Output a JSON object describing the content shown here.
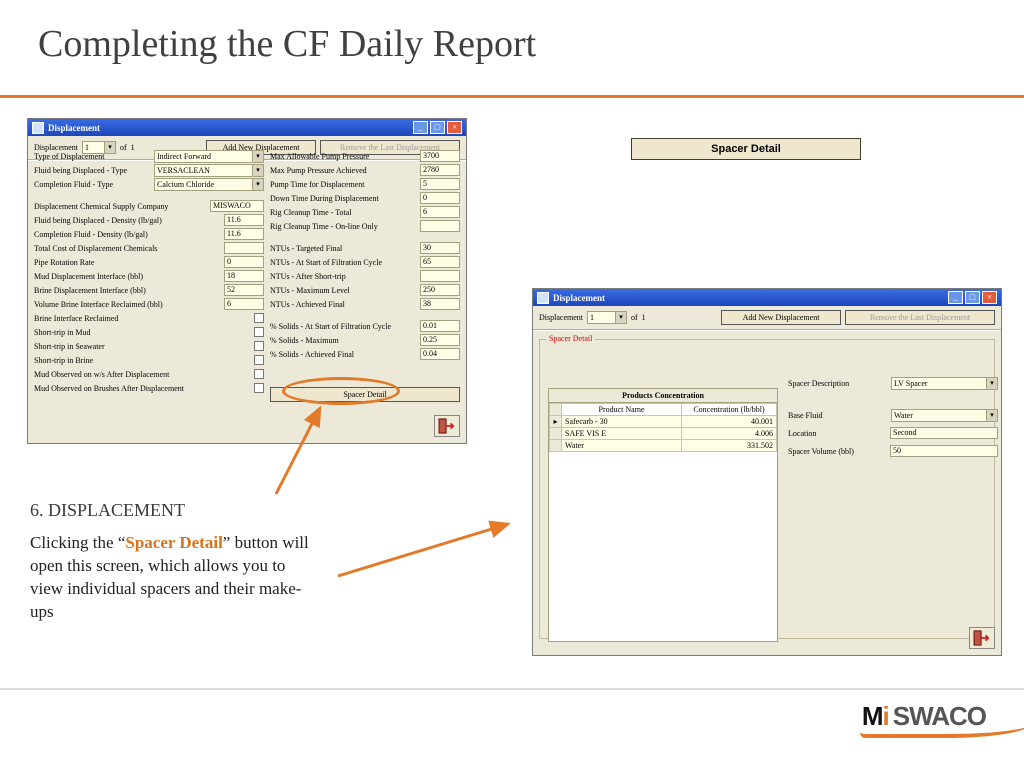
{
  "slide": {
    "title": "Completing the CF Daily Report",
    "callout_button": "Spacer Detail",
    "section_heading": "6.  DISPLACEMENT",
    "body_pre": "Clicking  the “",
    "body_hl": "Spacer Detail",
    "body_post": "” button will  open this screen, which allows you to view individual  spacers and their make-ups"
  },
  "logo": {
    "part1": "M",
    "dot": "i",
    "part2": " SWACO"
  },
  "w1": {
    "title": "Displacement",
    "nav_label": "Displacement",
    "nav_value": "1",
    "nav_of": "of",
    "nav_total": "1",
    "btn_add": "Add New Displacement",
    "btn_remove": "Remove the Last Displacement",
    "left": {
      "type_lbl": "Type of Displacement",
      "type_val": "Indirect Forward",
      "fluid_type_lbl": "Fluid being Displaced - Type",
      "fluid_type_val": "VERSACLEAN",
      "comp_type_lbl": "Completion Fluid - Type",
      "comp_type_val": "Calcium Chloride",
      "supplier_lbl": "Displacement Chemical Supply Company",
      "supplier_val": "MISWACO",
      "fluid_dens_lbl": "Fluid being Displaced - Density (lb/gal)",
      "fluid_dens_val": "11.6",
      "comp_dens_lbl": "Completion Fluid - Density (lb/gal)",
      "comp_dens_val": "11.6",
      "cost_lbl": "Total Cost of Displacement Chemicals",
      "cost_val": "",
      "pipe_lbl": "Pipe Rotation Rate",
      "pipe_val": "0",
      "mud_if_lbl": "Mud Displacement Interface (bbl)",
      "mud_if_val": "18",
      "brine_if_lbl": "Brine Displacement Interface (bbl)",
      "brine_if_val": "52",
      "vol_if_lbl": "Volume Brine Interface Reclaimed (bbl)",
      "vol_if_val": "6",
      "bir_lbl": "Brine Interface Reclaimed",
      "stm_lbl": "Short-trip in Mud",
      "sts_lbl": "Short-trip in Seawater",
      "stb_lbl": "Short-trip in Brine",
      "mows_lbl": "Mud Observed on w/s After Displacement",
      "mob_lbl": "Mud Observed on Brushes After Displacement"
    },
    "right": {
      "r1_lbl": "Max Allowable Pump Pressure",
      "r1_val": "3700",
      "r2_lbl": "Max Pump Pressure Achieved",
      "r2_val": "2780",
      "r3_lbl": "Pump Time for Displacement",
      "r3_val": "5",
      "r4_lbl": "Down Time During Displacement",
      "r4_val": "0",
      "r5_lbl": "Rig Cleanup Time - Total",
      "r5_val": "6",
      "r6_lbl": "Rig Cleanup Time - On-line Only",
      "r6_val": "",
      "n1_lbl": "NTUs - Targeted Final",
      "n1_val": "30",
      "n2_lbl": "NTUs - At Start of Filtration Cycle",
      "n2_val": "65",
      "n3_lbl": "NTUs - After Short-trip",
      "n3_val": "",
      "n4_lbl": "NTUs - Maximum Level",
      "n4_val": "250",
      "n5_lbl": "NTUs - Achieved Final",
      "n5_val": "38",
      "s1_lbl": "% Solids - At Start of Filtration Cycle",
      "s1_val": "0.01",
      "s2_lbl": "% Solids - Maximum",
      "s2_val": "0.25",
      "s3_lbl": "% Solids - Achieved Final",
      "s3_val": "0.04"
    },
    "spacer_btn": "Spacer Detail"
  },
  "w2": {
    "title": "Displacement",
    "nav_label": "Displacement",
    "nav_value": "1",
    "nav_of": "of",
    "nav_total": "1",
    "btn_add": "Add New Displacement",
    "btn_remove": "Remove the Last Displacement",
    "legend": "Spacer Detail",
    "grid_title": "Products Concentration",
    "col1": "Product Name",
    "col2": "Concentration (lb/bbl)",
    "rows": [
      {
        "name": "Safecarb - 30",
        "conc": "40.001"
      },
      {
        "name": "SAFE VIS E",
        "conc": "4.006"
      },
      {
        "name": "Water",
        "conc": "331.502"
      }
    ],
    "right": {
      "desc_lbl": "Spacer Description",
      "desc_val": "LV Spacer",
      "base_lbl": "Base Fluid",
      "base_val": "Water",
      "loc_lbl": "Location",
      "loc_val": "Second",
      "vol_lbl": "Spacer Volume (bbl)",
      "vol_val": "50"
    }
  }
}
